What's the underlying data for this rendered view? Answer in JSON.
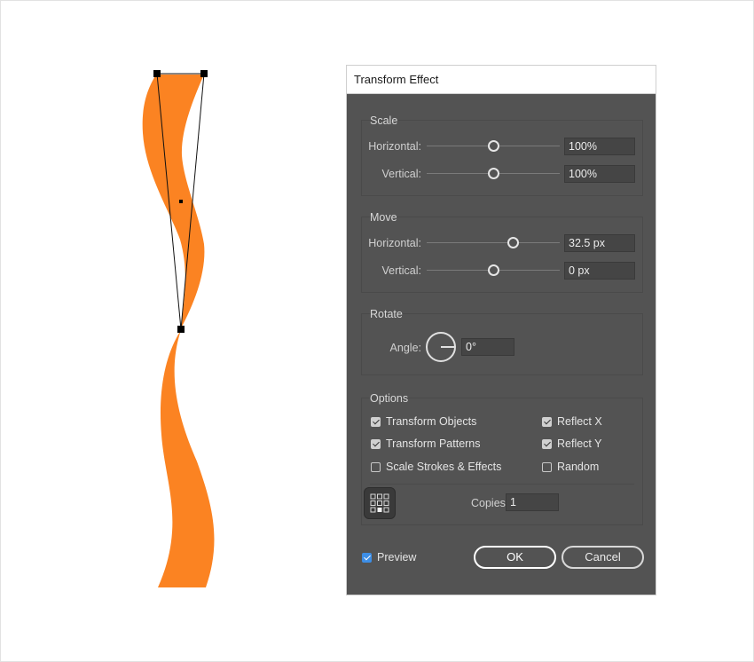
{
  "dialog": {
    "title": "Transform Effect",
    "scale": {
      "title": "Scale",
      "horizontal_label": "Horizontal:",
      "horizontal_value": "100%",
      "horizontal_level": 0.5,
      "vertical_label": "Vertical:",
      "vertical_value": "100%",
      "vertical_level": 0.5
    },
    "move": {
      "title": "Move",
      "horizontal_label": "Horizontal:",
      "horizontal_value": "32.5 px",
      "horizontal_level": 0.65,
      "vertical_label": "Vertical:",
      "vertical_value": "0 px",
      "vertical_level": 0.5
    },
    "rotate": {
      "title": "Rotate",
      "angle_label": "Angle:",
      "angle_value": "0°"
    },
    "options": {
      "title": "Options",
      "transform_objects": {
        "label": "Transform Objects",
        "checked": true
      },
      "transform_patterns": {
        "label": "Transform Patterns",
        "checked": true
      },
      "scale_strokes": {
        "label": "Scale Strokes & Effects",
        "checked": false
      },
      "reflect_x": {
        "label": "Reflect X",
        "checked": true
      },
      "reflect_y": {
        "label": "Reflect Y",
        "checked": true
      },
      "random": {
        "label": "Random",
        "checked": false
      },
      "copies_label": "Copies",
      "copies_value": "1"
    },
    "preview": {
      "label": "Preview",
      "checked": true
    },
    "ok_label": "OK",
    "cancel_label": "Cancel"
  },
  "colors": {
    "ribbon": "#fb8322",
    "dialog_bg": "#535353",
    "accent": "#3d8ee6"
  },
  "icons": [
    "reference-point-icon",
    "angle-dial-icon",
    "checkbox-icon"
  ]
}
